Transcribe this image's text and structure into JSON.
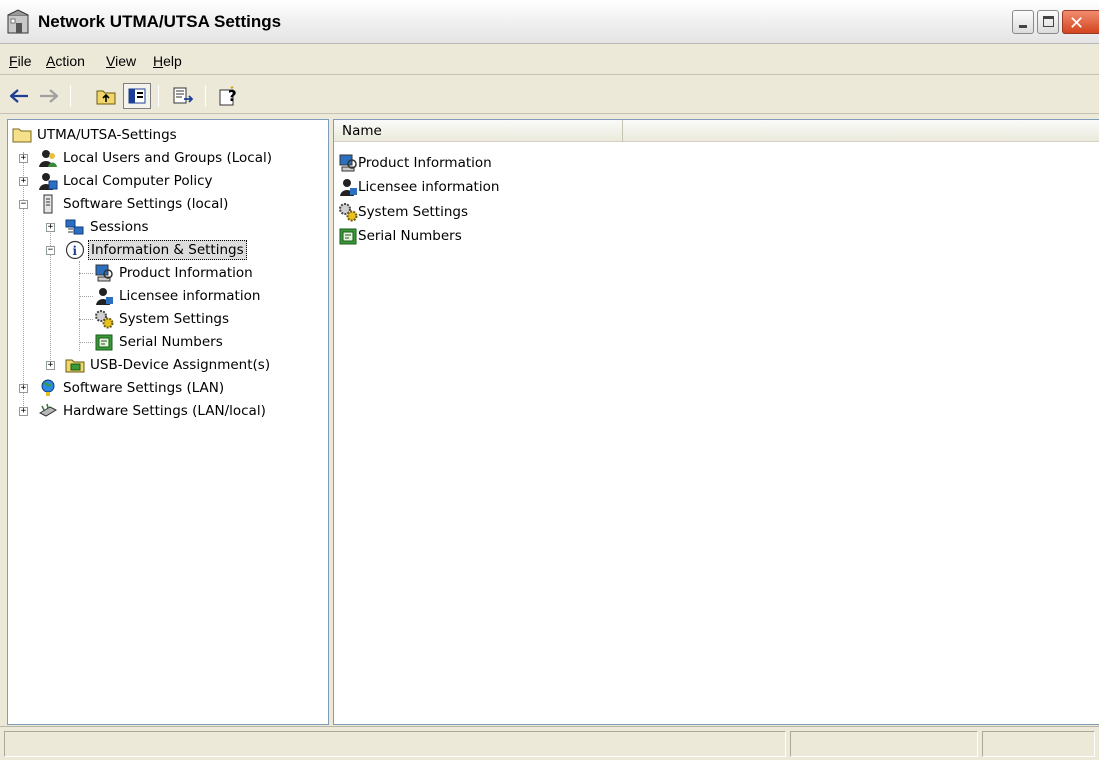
{
  "window": {
    "title": "Network UTMA/UTSA Settings",
    "title_icon": "mmc-console-icon",
    "buttons": [
      "minimize-icon",
      "maximize-icon",
      "close-icon"
    ]
  },
  "menu": [
    {
      "label": "File"
    },
    {
      "label": "Action"
    },
    {
      "label": "View"
    },
    {
      "label": "Help"
    }
  ],
  "toolbar": [
    "back-icon",
    "forward-icon",
    "up-one-level-icon",
    "show-hide-tree-icon",
    "export-list-icon",
    "help-icon"
  ],
  "tree": {
    "root": "UTMA/UTSA-Settings",
    "nodes": [
      {
        "label": "Local Users and Groups (Local)",
        "icon": "users-icon"
      },
      {
        "label": "Local Computer Policy",
        "icon": "policy-icon"
      },
      {
        "label": "Software Settings (local)",
        "icon": "server-icon"
      },
      {
        "label": "Sessions",
        "icon": "sessions-icon"
      },
      {
        "label": "Information & Settings",
        "icon": "info-icon"
      },
      {
        "label": "Product Information",
        "icon": "product-info-icon"
      },
      {
        "label": "Licensee information",
        "icon": "licensee-icon"
      },
      {
        "label": "System Settings",
        "icon": "gears-icon"
      },
      {
        "label": "Serial Numbers",
        "icon": "serial-numbers-icon"
      },
      {
        "label": "USB-Device Assignment(s)",
        "icon": "usb-folder-icon"
      },
      {
        "label": "Software Settings (LAN)",
        "icon": "globe-icon"
      },
      {
        "label": "Hardware Settings (LAN/local)",
        "icon": "hardware-icon"
      }
    ]
  },
  "list": {
    "column": "Name",
    "items": [
      {
        "label": "Product Information",
        "icon": "product-info-icon"
      },
      {
        "label": "Licensee information",
        "icon": "licensee-icon"
      },
      {
        "label": "System Settings",
        "icon": "gears-icon"
      },
      {
        "label": "Serial Numbers",
        "icon": "serial-numbers-icon"
      }
    ]
  },
  "colors": {
    "chrome": "#ece9d8",
    "pane_border": "#7f9db9",
    "close_button": "#d2451f"
  }
}
